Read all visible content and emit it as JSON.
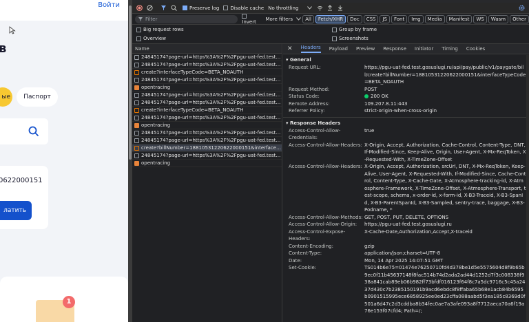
{
  "page": {
    "login_label": "Войти",
    "heading_fragment": "в",
    "pill_yellow_label": "ые",
    "pill_passport_label": "Паспорт",
    "card_number": "0622000151",
    "pay_label": "латить",
    "envelope_badge": "1"
  },
  "toolbar": {
    "preserve_log": "Preserve log",
    "disable_cache": "Disable cache",
    "throttling": "No throttling"
  },
  "filterbar": {
    "placeholder": "Filter",
    "invert": "Invert",
    "more_filters": "More filters",
    "chips": [
      "All",
      "Fetch/XHR",
      "Doc",
      "CSS",
      "JS",
      "Font",
      "Img",
      "Media",
      "Manifest",
      "WS",
      "Wasm",
      "Other"
    ]
  },
  "options": {
    "big_request_rows": "Big request rows",
    "overview": "Overview",
    "group_by_frame": "Group by frame",
    "screenshots": "Screenshots"
  },
  "list": {
    "header": "Name",
    "rows": [
      {
        "text": "24845174?page-url=https%3A%2F%2Fpgu-uat-fed.test.g...fuu7%...",
        "kind": "xhr"
      },
      {
        "text": "24845174?page-url=https%3A%2F%2Fpgu-uat-fed.test.g...fuu7%...",
        "kind": "xhr"
      },
      {
        "text": "create?interfaceTypeCode=BETA_NOAUTH",
        "kind": "js"
      },
      {
        "text": "24845174?page-url=https%3A%2F%2Fpgu-uat-fed.test.g...fuu7%...",
        "kind": "xhr"
      },
      {
        "text": "opentracing",
        "kind": "trc"
      },
      {
        "text": "24845174?page-url=https%3A%2F%2Fpgu-uat-fed.test.g...fuu7%...",
        "kind": "xhr"
      },
      {
        "text": "24845174?page-url=https%3A%2F%2Fpgu-uat-fed.test.g...fuu7%...",
        "kind": "xhr"
      },
      {
        "text": "create?interfaceTypeCode=BETA_NOAUTH",
        "kind": "js"
      },
      {
        "text": "24845174?page-url=https%3A%2F%2Fpgu-uat-fed.test.g...fuu7%...",
        "kind": "xhr"
      },
      {
        "text": "opentracing",
        "kind": "trc"
      },
      {
        "text": "24845174?page-url=https%3A%2F%2Fpgu-uat-fed.test.g...fuu7%...",
        "kind": "xhr"
      },
      {
        "text": "24845174?page-url=https%3A%2F%2Fpgu-uat-fed.test.g...fuu7%...",
        "kind": "xhr"
      },
      {
        "text": "create?billNumber=18810531220622000151&interfaceTypeCode...",
        "kind": "js",
        "selected": true
      },
      {
        "text": "24845174?page-url=https%3A%2F%2Fpgu-uat-fed.test.g...fuu7%...",
        "kind": "xhr"
      },
      {
        "text": "opentracing",
        "kind": "trc"
      }
    ]
  },
  "detail": {
    "tabs": [
      "Headers",
      "Payload",
      "Preview",
      "Response",
      "Initiator",
      "Timing",
      "Cookies"
    ],
    "general_title": "General",
    "general": [
      {
        "k": "Request URL:",
        "v": "https://pgu-uat-fed.test.gosuslugi.ru/api/pay/public/v1/paygate/bill/create?billNumber=18810531220622000151&interfaceTypeCode=BETA_NOAUTH"
      },
      {
        "k": "Request Method:",
        "v": "POST"
      },
      {
        "k": "Status Code:",
        "v": "200 OK"
      },
      {
        "k": "Remote Address:",
        "v": "109.207.8.11:443"
      },
      {
        "k": "Referrer Policy:",
        "v": "strict-origin-when-cross-origin"
      }
    ],
    "response_title": "Response Headers",
    "response": [
      {
        "k": "Access-Control-Allow-Credentials:",
        "v": "true"
      },
      {
        "k": "Access-Control-Allow-Headers:",
        "v": "X-Origin, Accept, Authorization, Cache-Control, Content-Type, DNT, If-Modified-Since, Keep-Alive, Origin, User-Agent, X-Mx-ReqToken, X-Requested-With, X-TimeZone-Offset"
      },
      {
        "k": "Access-Control-Allow-Headers:",
        "v": "X-Origin, Accept, Authorization, srcUrl, DNT, X-Mx-ReqToken, Keep-Alive, User-Agent, X-Requested-With, If-Modified-Since, Cache-Control, Content-Type, X-Cache-Date, X-Atmosphere-tracking-id, X-Atmosphere-Framework, X-TimeZone-Offset, X-Atmosphere-Transport, test-scope, schema, x-order-id, x-form-id, X-B3-Traceid, X-B3-SpanId, X-B3-ParentSpanId, X-B3-Sampled, sentry-trace, baggage, X-B3-Podname, *"
      },
      {
        "k": "Access-Control-Allow-Methods:",
        "v": "GET, POST, PUT, DELETE, OPTIONS"
      },
      {
        "k": "Access-Control-Allow-Origin:",
        "v": "https://pgu-uat-fed.test.gosuslugi.ru"
      },
      {
        "k": "Access-Control-Expose-Headers:",
        "v": "X-Cache-Date,Authorization,Accept,X-traceid"
      },
      {
        "k": "Content-Encoding:",
        "v": "gzip"
      },
      {
        "k": "Content-Type:",
        "v": "application/json;charset=UTF-8"
      },
      {
        "k": "Date:",
        "v": "Mon, 14 Apr 2025 14:07:51 GMT"
      },
      {
        "k": "Set-Cookie:",
        "v": "TS014b6e75=01474e76250710fd4d378be1d5e5575604d8f9b65b9ec0f11b45637148f8fac514b74d2ada2ad44d1252d7f3c008338f938a841cab89eb06b982ff73bfdf016123f64f8c7a5dc9716c5c45a2437d430c7b2385150191b9acd6ebdc8f8ffaba65b68e1acb84b6595b0901515995ece6858925ee0ed23cffa088aabd5f3ea185c8369d0f501a6d47c2d3cddba8b34fec0ae7a3afe093a8f7712aeca70a6f19a76e153f07cfd4; Path=/;"
      }
    ]
  }
}
